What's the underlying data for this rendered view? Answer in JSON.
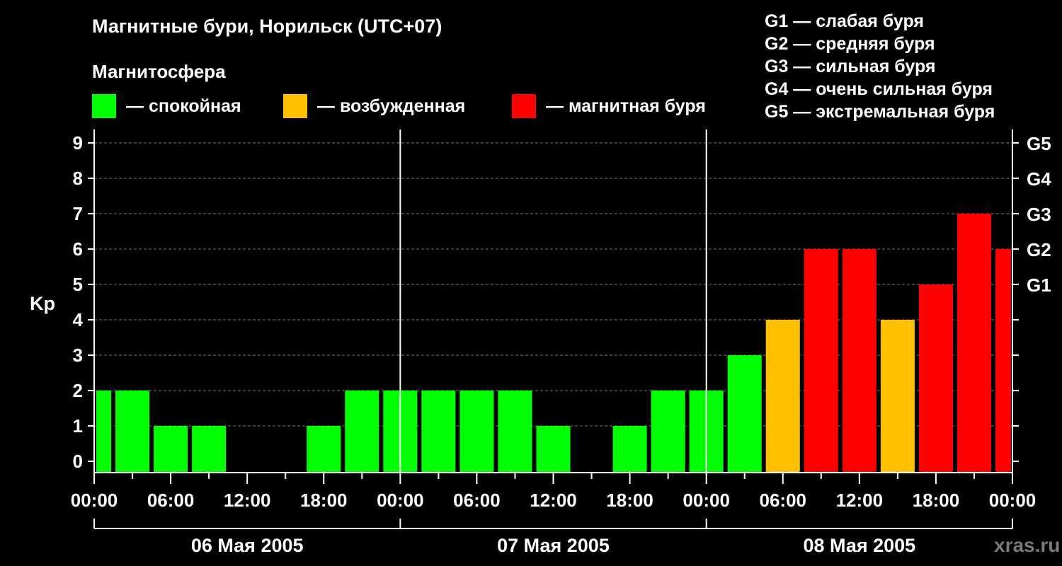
{
  "chart_data": {
    "type": "bar",
    "title": "Магнитные бури, Норильск (UTC+07)",
    "ylabel": "Kp",
    "ylim": [
      0,
      9
    ],
    "yticks": [
      0,
      1,
      2,
      3,
      4,
      5,
      6,
      7,
      8,
      9
    ],
    "grid": true,
    "storm_levels": [
      {
        "label": "G1",
        "kp": 5
      },
      {
        "label": "G2",
        "kp": 6
      },
      {
        "label": "G3",
        "kp": 7
      },
      {
        "label": "G4",
        "kp": 8
      },
      {
        "label": "G5",
        "kp": 9
      }
    ],
    "x_tick_labels": [
      "00:00",
      "06:00",
      "12:00",
      "18:00",
      "00:00",
      "06:00",
      "12:00",
      "18:00",
      "00:00",
      "06:00",
      "12:00",
      "18:00",
      "00:00"
    ],
    "days": [
      "06 Мая 2005",
      "07 Мая 2005",
      "08 Мая 2005"
    ],
    "interval_hours": 3,
    "values": [
      2,
      2,
      1,
      1,
      0,
      0,
      1,
      2,
      2,
      2,
      2,
      2,
      1,
      0,
      1,
      2,
      2,
      3,
      4,
      6,
      6,
      4,
      5,
      7,
      6
    ],
    "colors": {
      "calm": "#00ff00",
      "excited": "#ffc000",
      "storm": "#ff0000"
    }
  },
  "legend": {
    "title": "Магнитосфера",
    "items": [
      {
        "label": "— спокойная",
        "color": "#00ff00"
      },
      {
        "label": "— возбужденная",
        "color": "#ffc000"
      },
      {
        "label": "— магнитная буря",
        "color": "#ff0000"
      }
    ]
  },
  "g_scale": [
    "G1 — слабая буря",
    "G2 — средняя буря",
    "G3 — сильная буря",
    "G4 — очень сильная буря",
    "G5 — экстремальная буря"
  ],
  "watermark": "xras.ru"
}
